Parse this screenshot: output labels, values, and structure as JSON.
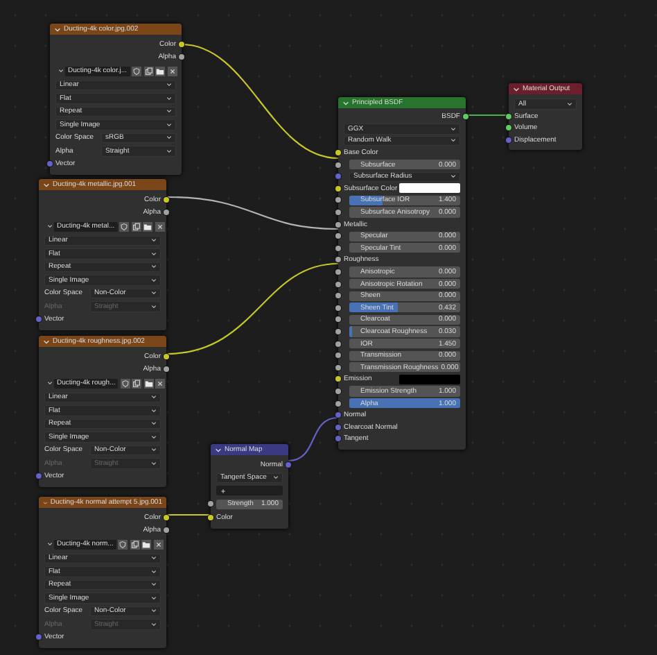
{
  "image_nodes": [
    {
      "title": "Ducting-4k color.jpg.002",
      "outputs": [
        {
          "label": "Color",
          "color": "#c7c729"
        },
        {
          "label": "Alpha",
          "color": "#a1a1a1"
        }
      ],
      "file": "Ducting-4k color.j...",
      "options": [
        "Linear",
        "Flat",
        "Repeat",
        "Single Image"
      ],
      "settings": [
        {
          "label": "Color Space",
          "value": "sRGB",
          "disabled": false
        },
        {
          "label": "Alpha",
          "value": "Straight",
          "disabled": false
        }
      ],
      "input": {
        "label": "Vector",
        "color": "#6363c7"
      }
    },
    {
      "title": "Ducting-4k metallic.jpg.001",
      "outputs": [
        {
          "label": "Color",
          "color": "#c7c729"
        },
        {
          "label": "Alpha",
          "color": "#a1a1a1"
        }
      ],
      "file": "Ducting-4k metal...",
      "options": [
        "Linear",
        "Flat",
        "Repeat",
        "Single Image"
      ],
      "settings": [
        {
          "label": "Color Space",
          "value": "Non-Color",
          "disabled": false
        },
        {
          "label": "Alpha",
          "value": "Straight",
          "disabled": true
        }
      ],
      "input": {
        "label": "Vector",
        "color": "#6363c7"
      }
    },
    {
      "title": "Ducting-4k roughness.jpg.002",
      "outputs": [
        {
          "label": "Color",
          "color": "#c7c729"
        },
        {
          "label": "Alpha",
          "color": "#a1a1a1"
        }
      ],
      "file": "Ducting-4k rough...",
      "options": [
        "Linear",
        "Flat",
        "Repeat",
        "Single Image"
      ],
      "settings": [
        {
          "label": "Color Space",
          "value": "Non-Color",
          "disabled": false
        },
        {
          "label": "Alpha",
          "value": "Straight",
          "disabled": true
        }
      ],
      "input": {
        "label": "Vector",
        "color": "#6363c7"
      }
    },
    {
      "title": "Ducting-4k normal attempt 5.jpg.001",
      "outputs": [
        {
          "label": "Color",
          "color": "#c7c729"
        },
        {
          "label": "Alpha",
          "color": "#a1a1a1"
        }
      ],
      "file": "Ducting-4k norm...",
      "options": [
        "Linear",
        "Flat",
        "Repeat",
        "Single Image"
      ],
      "settings": [
        {
          "label": "Color Space",
          "value": "Non-Color",
          "disabled": false
        },
        {
          "label": "Alpha",
          "value": "Straight",
          "disabled": true
        }
      ],
      "input": {
        "label": "Vector",
        "color": "#6363c7"
      }
    }
  ],
  "normal_map": {
    "title": "Normal Map",
    "output": {
      "label": "Normal",
      "color": "#6363c7"
    },
    "space": "Tangent Space",
    "strength": {
      "label": "Strength",
      "reading": "1.000",
      "color": "#a1a1a1"
    },
    "input": {
      "label": "Color",
      "color": "#c7c729"
    }
  },
  "bsdf": {
    "title": "Principled BSDF",
    "rows": [
      {
        "kind": "output",
        "label": "BSDF",
        "color": "#63c763"
      },
      {
        "kind": "dropdown",
        "label": "GGX"
      },
      {
        "kind": "dropdown",
        "label": "Random Walk"
      },
      {
        "kind": "input",
        "label": "Base Color",
        "color": "#c7c729"
      },
      {
        "kind": "number",
        "label": "Subsurface",
        "reading": "0.000",
        "color": "#a1a1a1"
      },
      {
        "kind": "dropdown",
        "label": "Subsurface Radius",
        "color": "#6363c7"
      },
      {
        "kind": "swatch",
        "label": "Subsurface Color",
        "color": "#ffffff"
      },
      {
        "kind": "slider",
        "label": "Subsurface IOR",
        "reading": "1.400",
        "level": 0.3,
        "color": "#a1a1a1"
      },
      {
        "kind": "number",
        "label": "Subsurface Anisotropy",
        "reading": "0.000",
        "color": "#a1a1a1"
      },
      {
        "kind": "input",
        "label": "Metallic",
        "color": "#a1a1a1"
      },
      {
        "kind": "number",
        "label": "Specular",
        "reading": "0.000",
        "color": "#a1a1a1"
      },
      {
        "kind": "number",
        "label": "Specular Tint",
        "reading": "0.000",
        "color": "#a1a1a1"
      },
      {
        "kind": "input",
        "label": "Roughness",
        "color": "#a1a1a1"
      },
      {
        "kind": "number",
        "label": "Anisotropic",
        "reading": "0.000",
        "color": "#a1a1a1"
      },
      {
        "kind": "number",
        "label": "Anisotropic Rotation",
        "reading": "0.000",
        "color": "#a1a1a1"
      },
      {
        "kind": "number",
        "label": "Sheen",
        "reading": "0.000",
        "color": "#a1a1a1"
      },
      {
        "kind": "slider",
        "label": "Sheen Tint",
        "reading": "0.432",
        "level": 0.432,
        "color": "#a1a1a1"
      },
      {
        "kind": "number",
        "label": "Clearcoat",
        "reading": "0.000",
        "color": "#a1a1a1"
      },
      {
        "kind": "slider",
        "label": "Clearcoat Roughness",
        "reading": "0.030",
        "level": 0.03,
        "color": "#a1a1a1"
      },
      {
        "kind": "number",
        "label": "IOR",
        "reading": "1.450",
        "color": "#a1a1a1"
      },
      {
        "kind": "number",
        "label": "Transmission",
        "reading": "0.000",
        "color": "#a1a1a1"
      },
      {
        "kind": "number",
        "label": "Transmission Roughness",
        "reading": "0.000",
        "color": "#a1a1a1"
      },
      {
        "kind": "swatch",
        "label": "Emission",
        "color": "#000000"
      },
      {
        "kind": "number",
        "label": "Emission Strength",
        "reading": "1.000",
        "color": "#a1a1a1"
      },
      {
        "kind": "slider",
        "label": "Alpha",
        "reading": "1.000",
        "level": 1,
        "color": "#a1a1a1"
      },
      {
        "kind": "input",
        "label": "Normal",
        "color": "#6363c7"
      },
      {
        "kind": "input",
        "label": "Clearcoat Normal",
        "color": "#6363c7"
      },
      {
        "kind": "input",
        "label": "Tangent",
        "color": "#6363c7"
      }
    ]
  },
  "material_output": {
    "title": "Material Output",
    "target": "All",
    "inputs": [
      {
        "label": "Surface",
        "color": "#63c763"
      },
      {
        "label": "Volume",
        "color": "#63c763"
      },
      {
        "label": "Displacement",
        "color": "#6363c7"
      }
    ]
  }
}
